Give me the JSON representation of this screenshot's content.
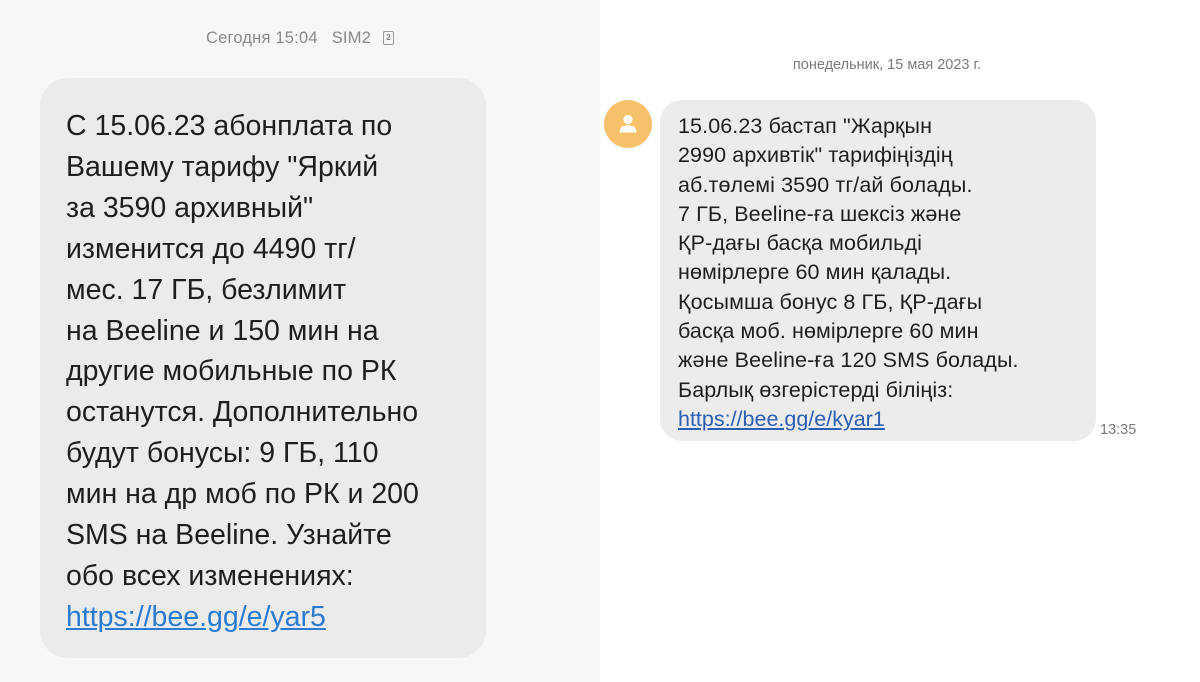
{
  "left_screen": {
    "header": {
      "timestamp": "Сегодня 15:04",
      "sim": "SIM2",
      "sim_icon": "sim2-icon",
      "sim_icon_label": "2"
    },
    "message": {
      "lines": [
        "С 15.06.23 абонплата по",
        "Вашему тарифу \"Яркий",
        "за 3590 архивный\"",
        "изменится до 4490 тг/",
        "мес. 17 ГБ, безлимит",
        "на Beeline и 150 мин на",
        "другие мобильные по РК",
        "останутся. Дополнительно",
        "будут бонусы: 9 ГБ, 110",
        "мин на др моб по РК и 200",
        "SMS на Beeline. Узнайте",
        "обо всех изменениях:"
      ],
      "link": "https://bee.gg/e/yar5"
    }
  },
  "right_screen": {
    "date_header": "понедельник, 15 мая 2023 г.",
    "avatar_icon": "contact-avatar-icon",
    "colors": {
      "avatar": "#f5c16a",
      "link": "#2b5fb4"
    },
    "message": {
      "lines": [
        "15.06.23 бастап \"Жарқын",
        "2990 архивтік\" тарифіңіздің",
        "аб.төлемі 3590 тг/ай болады.",
        "7 ГБ, Beeline-ға шексіз және",
        "ҚР-дағы басқа мобильді",
        "нөмірлерге 60 мин қалады.",
        "Қосымша бонус 8 ГБ, ҚР-дағы",
        "басқа моб. нөмірлерге 60 мин",
        "және Beeline-ға 120 SMS болады.",
        "Барлық өзгерістерді біліңіз:"
      ],
      "link": "https://bee.gg/e/kyar1",
      "time": "13:35"
    }
  }
}
